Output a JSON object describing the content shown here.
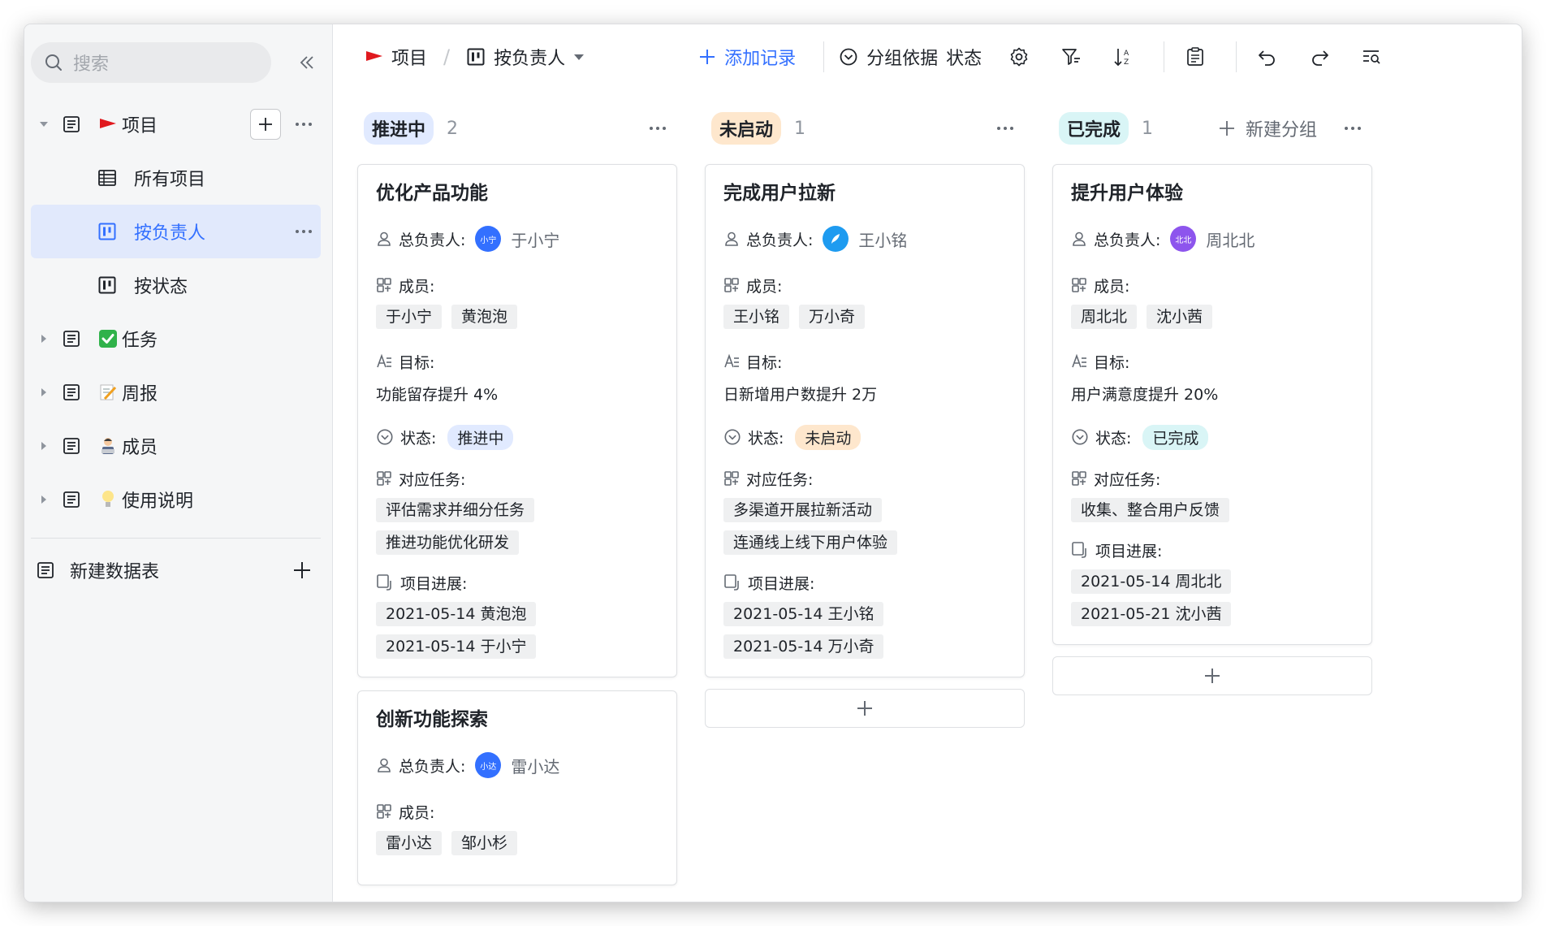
{
  "colors": {
    "accent": "#3370ff",
    "in_progress_bg": "#e1eaff",
    "not_started_bg": "#fee7cd",
    "done_bg": "#d9f5f6",
    "avatar_xiaoning": "#3370ff",
    "avatar_wangxiaoming": "#1e9bf0",
    "avatar_zhoubeibei": "#8d55ed",
    "avatar_leixiaoda": "#3370ff"
  },
  "sidebar": {
    "search_placeholder": "搜索",
    "tree": [
      {
        "label": "项目",
        "emoji": "red-flag"
      },
      {
        "label": "所有项目",
        "icon": "grid-table-icon"
      },
      {
        "label": "按负责人",
        "icon": "kanban-icon"
      },
      {
        "label": "按状态",
        "icon": "kanban-icon"
      },
      {
        "label": "任务",
        "emoji": "check-mark"
      },
      {
        "label": "周报",
        "emoji": "memo"
      },
      {
        "label": "成员",
        "emoji": "technologist"
      },
      {
        "label": "使用说明",
        "emoji": "light-bulb"
      }
    ],
    "new_table": "新建数据表"
  },
  "toolbar": {
    "breadcrumb_table": "项目",
    "breadcrumb_view": "按负责人",
    "add_record": "添加记录",
    "group_by_label": "分组依据",
    "group_by_value": "状态"
  },
  "board": {
    "new_group": "新建分组",
    "columns": [
      {
        "tag": "推进中",
        "count": "2",
        "cards": [
          {
            "title": "优化产品功能",
            "owner_label": "总负责人:",
            "owner_avatar": "小宁",
            "owner_name": "于小宁",
            "members_label": "成员:",
            "members": [
              "于小宁",
              "黄泡泡"
            ],
            "goal_label": "目标:",
            "goal": "功能留存提升 4%",
            "status_label": "状态:",
            "status": "推进中",
            "tasks_label": "对应任务:",
            "tasks": [
              "评估需求并细分任务",
              "推进功能优化研发"
            ],
            "progress_label": "项目进展:",
            "progress": [
              "2021-05-14 黄泡泡",
              "2021-05-14 于小宁"
            ]
          },
          {
            "title": "创新功能探索",
            "owner_label": "总负责人:",
            "owner_avatar": "小达",
            "owner_name": "雷小达",
            "members_label": "成员:",
            "members": [
              "雷小达",
              "邹小杉"
            ]
          }
        ]
      },
      {
        "tag": "未启动",
        "count": "1",
        "cards": [
          {
            "title": "完成用户拉新",
            "owner_label": "总负责人:",
            "owner_name": "王小铭",
            "members_label": "成员:",
            "members": [
              "王小铭",
              "万小奇"
            ],
            "goal_label": "目标:",
            "goal": "日新增用户数提升 2万",
            "status_label": "状态:",
            "status": "未启动",
            "tasks_label": "对应任务:",
            "tasks": [
              "多渠道开展拉新活动",
              "连通线上线下用户体验"
            ],
            "progress_label": "项目进展:",
            "progress": [
              "2021-05-14 王小铭",
              "2021-05-14 万小奇"
            ]
          }
        ]
      },
      {
        "tag": "已完成",
        "count": "1",
        "cards": [
          {
            "title": "提升用户体验",
            "owner_label": "总负责人:",
            "owner_avatar": "北北",
            "owner_name": "周北北",
            "members_label": "成员:",
            "members": [
              "周北北",
              "沈小茜"
            ],
            "goal_label": "目标:",
            "goal": "用户满意度提升 20%",
            "status_label": "状态:",
            "status": "已完成",
            "tasks_label": "对应任务:",
            "tasks": [
              "收集、整合用户反馈"
            ],
            "progress_label": "项目进展:",
            "progress": [
              "2021-05-14 周北北",
              "2021-05-21 沈小茜"
            ]
          }
        ]
      }
    ]
  }
}
